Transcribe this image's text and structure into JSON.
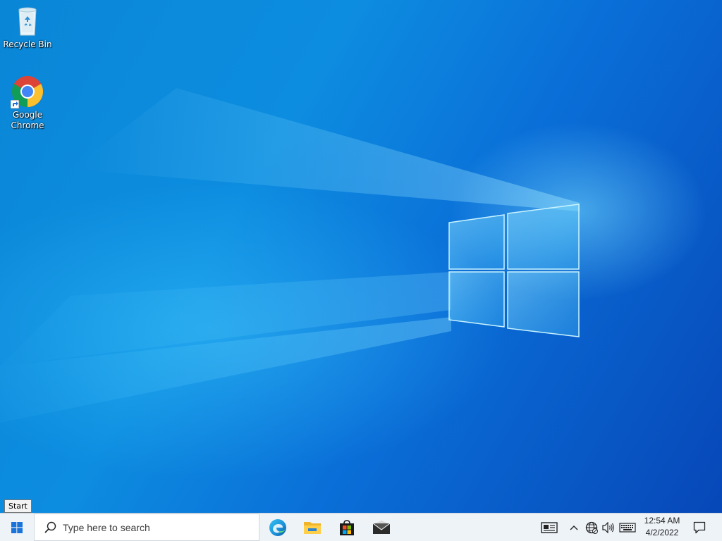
{
  "desktop": {
    "icons": [
      {
        "label": "Recycle Bin",
        "icon": "recycle-bin-icon"
      },
      {
        "label": "Google Chrome",
        "icon": "chrome-icon"
      }
    ],
    "tooltip": "Start"
  },
  "taskbar": {
    "search_placeholder": "Type here to search",
    "pinned_apps": [
      "Microsoft Edge",
      "File Explorer",
      "Microsoft Store",
      "Mail"
    ],
    "tray_icons": [
      "news-and-interests-icon",
      "chevron-up-icon",
      "network-icon",
      "volume-icon",
      "touch-keyboard-icon"
    ],
    "clock": {
      "time": "12:54 AM",
      "date": "4/2/2022"
    },
    "notifications_icon": "action-center-icon"
  },
  "colors": {
    "wallpaper_primary": "#0a86d6",
    "wallpaper_dark": "#0747b8",
    "taskbar_bg": "#eef3f8"
  }
}
